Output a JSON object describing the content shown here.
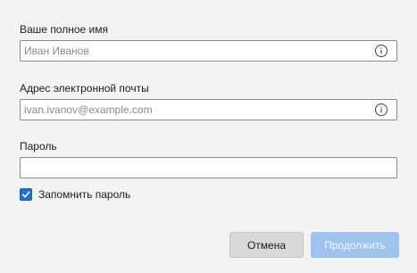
{
  "form": {
    "name": {
      "label": "Ваше полное имя",
      "placeholder": "Иван Иванов",
      "value": ""
    },
    "email": {
      "label": "Адрес электронной почты",
      "placeholder": "ivan.ivanov@example.com",
      "value": ""
    },
    "password": {
      "label": "Пароль",
      "value": ""
    },
    "remember": {
      "label": "Запомнить пароль",
      "checked": true
    }
  },
  "buttons": {
    "cancel": "Отмена",
    "continue": "Продолжить"
  },
  "colors": {
    "accent": "#1f6fd1",
    "primary_disabled": "#9fc3ef",
    "background": "#f3f3f3"
  },
  "icons": {
    "info": "info-icon",
    "check": "checkmark-icon"
  }
}
